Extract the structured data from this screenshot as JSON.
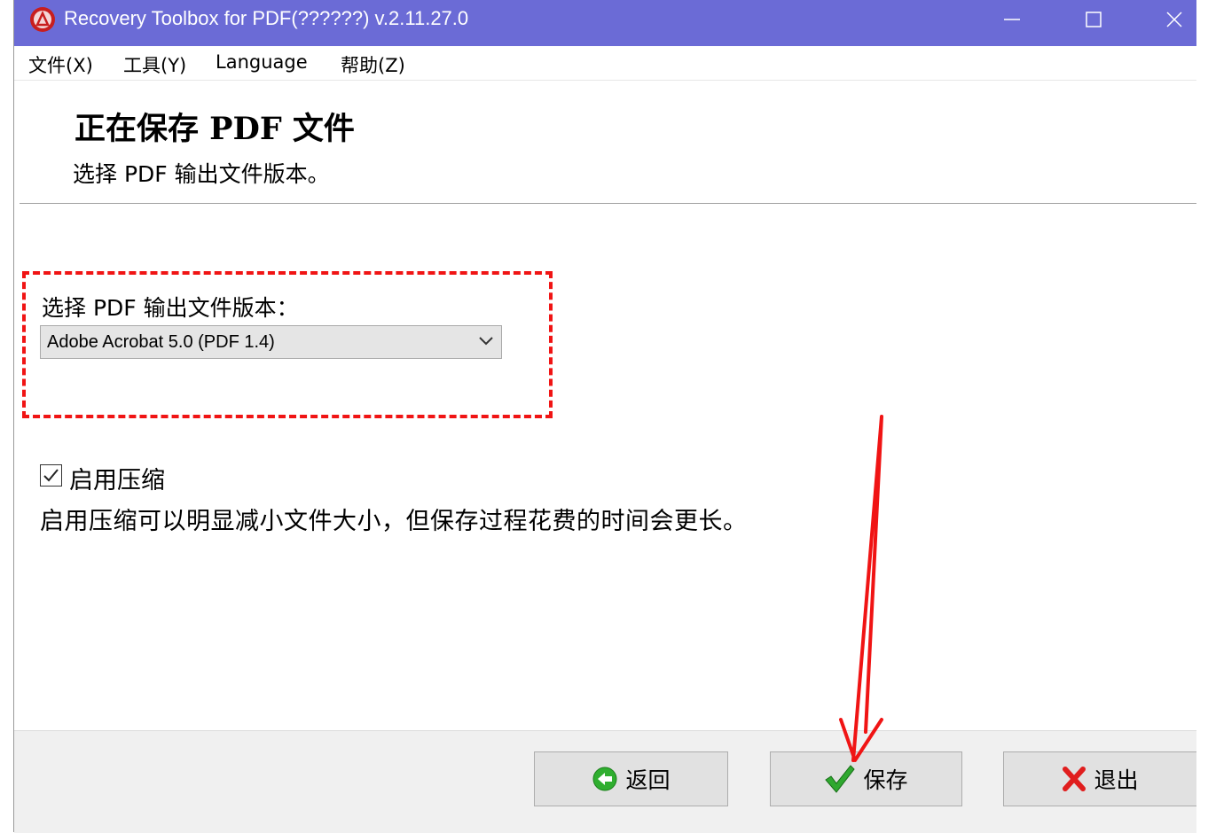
{
  "window": {
    "title": "Recovery Toolbox for PDF(??????) v.2.11.27.0",
    "title_bar_color": "#6b6bd6"
  },
  "titlebar_buttons": {
    "minimize_icon": "minimize-icon",
    "maximize_icon": "maximize-icon",
    "close_icon": "close-icon"
  },
  "menu": {
    "items": [
      {
        "label": "文件(X)"
      },
      {
        "label": "工具(Y)"
      },
      {
        "label": "Language"
      },
      {
        "label": "帮助(Z)"
      }
    ]
  },
  "header": {
    "title": "正在保存 PDF 文件",
    "subtitle": "选择 PDF 输出文件版本。"
  },
  "version": {
    "label": "选择 PDF 输出文件版本：",
    "selected": "Adobe Acrobat 5.0 (PDF 1.4)"
  },
  "compression": {
    "checked": true,
    "label": "启用压缩",
    "description": "启用压缩可以明显减小文件大小，但保存过程花费的时间会更长。"
  },
  "buttons": {
    "back": {
      "label": "返回",
      "icon": "arrow-left-circle-icon",
      "color": "#2fae2f"
    },
    "save": {
      "label": "保存",
      "icon": "checkmark-icon",
      "color": "#2fa82f"
    },
    "exit": {
      "label": "退出",
      "icon": "red-x-icon",
      "color": "#e01e1e"
    }
  },
  "annotation": {
    "highlight_color": "#f01414",
    "arrow_color": "#f01414"
  }
}
